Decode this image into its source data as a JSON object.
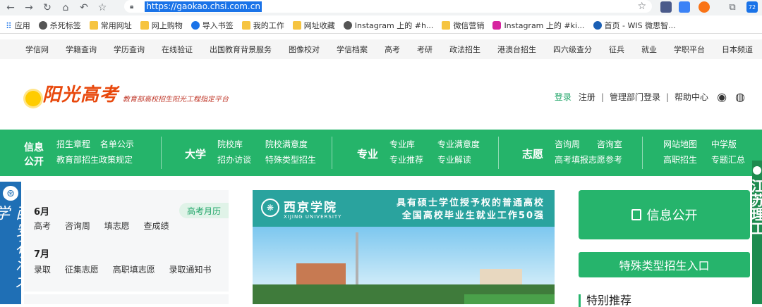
{
  "browser": {
    "url": "https://gaokao.chsi.com.cn",
    "nav_icons": [
      "back-arrow-icon",
      "forward-arrow-icon",
      "reload-icon",
      "home-icon",
      "history-back-icon",
      "star-icon"
    ],
    "ext_badge": "72"
  },
  "bookmarks": [
    {
      "label": "应用",
      "icon": "apps-icon"
    },
    {
      "label": "杀死标签",
      "icon": "globe-icon"
    },
    {
      "label": "常用网址",
      "icon": "folder-icon"
    },
    {
      "label": "网上购物",
      "icon": "folder-icon"
    },
    {
      "label": "导入书签",
      "icon": "gear-icon"
    },
    {
      "label": "我的工作",
      "icon": "folder-icon"
    },
    {
      "label": "网址收藏",
      "icon": "folder-icon"
    },
    {
      "label": "Instagram 上的 #h...",
      "icon": "globe-icon"
    },
    {
      "label": "微信营销",
      "icon": "folder-icon"
    },
    {
      "label": "Instagram 上的 #ki...",
      "icon": "instagram-icon"
    },
    {
      "label": "首页 - WIS 微思智...",
      "icon": "wis-icon"
    }
  ],
  "topnav": [
    "学信网",
    "学籍查询",
    "学历查询",
    "在线验证",
    "出国教育背景服务",
    "图像校对",
    "学信档案",
    "高考",
    "考研",
    "政法招生",
    "港澳台招生",
    "四六级查分",
    "征兵",
    "就业",
    "学职平台",
    "日本频道"
  ],
  "header": {
    "logo_title": "阳光高考",
    "logo_sub": "教育部高校招生阳光工程指定平台",
    "login": "登录",
    "register": "注册",
    "admin_login": "管理部门登录",
    "help": "帮助中心",
    "sep": "|"
  },
  "greennav": {
    "info_label_1": "信息",
    "info_label_2": "公开",
    "info_links": [
      "招生章程",
      "名单公示",
      "教育部招生政策规定"
    ],
    "uni_label": "大学",
    "uni_links": [
      "院校库",
      "院校满意度",
      "招办访谈",
      "特殊类型招生"
    ],
    "major_label": "专业",
    "major_links": [
      "专业库",
      "专业满意度",
      "专业推荐",
      "专业解读"
    ],
    "wish_label": "志愿",
    "wish_links": [
      "咨询周",
      "咨询室",
      "高考填报志愿参考"
    ],
    "other_links": [
      "网站地图",
      "中学版",
      "高职招生",
      "专题汇总"
    ]
  },
  "side_left": {
    "text": "西安石油大学"
  },
  "side_right": {
    "text": "江苏理工"
  },
  "calendar": {
    "tag": "高考月历",
    "june_label": "6月",
    "june_items": [
      "高考",
      "咨询周",
      "填志愿",
      "查成绩"
    ],
    "july_label": "7月",
    "july_items": [
      "录取",
      "征集志愿",
      "高职填志愿",
      "录取通知书"
    ]
  },
  "banner": {
    "university": "西京学院",
    "university_en": "XIJING UNIVERSITY",
    "slogan_1": "具有硕士学位授予权的普通高校",
    "slogan_2": "全国高校毕业生就业工作50强"
  },
  "right_panel": {
    "info_open": "信息公开",
    "special": "特殊类型招生入口",
    "recommend": "特别推荐"
  },
  "colors": {
    "brand_green": "#25b46a",
    "logo_orange": "#e8480c",
    "url_highlight": "#1a73e8"
  }
}
